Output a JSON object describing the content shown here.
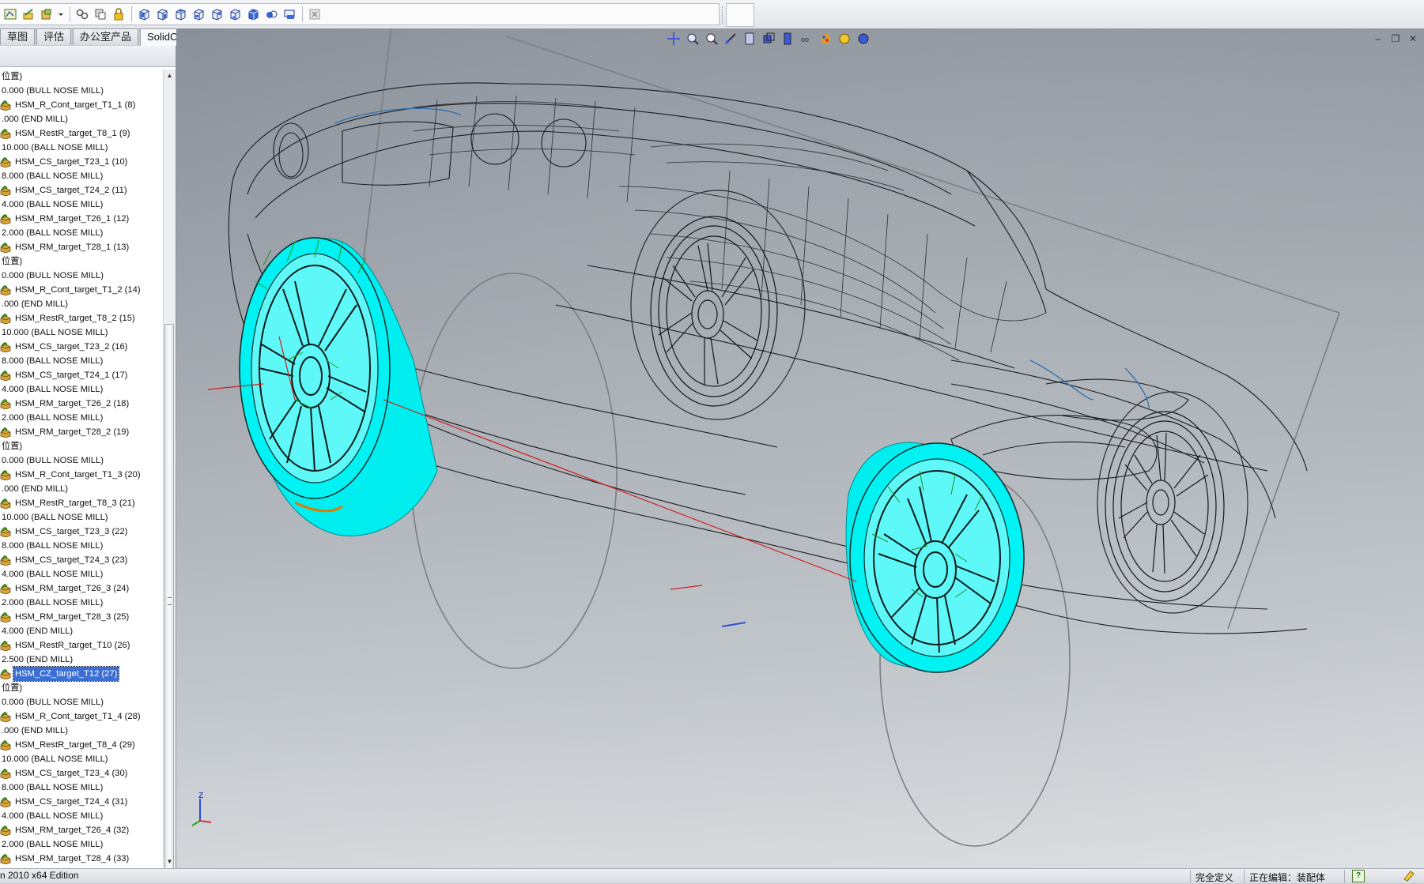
{
  "toolbar": {
    "icons": [
      "sketch-icon",
      "edit-part-icon",
      "component-icon",
      "dropdown-arrow-icon",
      "mate-icon",
      "move-component-icon",
      "lock-icon",
      "view-front-icon",
      "view-back-icon",
      "view-left-icon",
      "view-right-icon",
      "view-top-icon",
      "view-bottom-icon",
      "view-iso-icon",
      "view-trimetric-icon",
      "view-dimetric-icon",
      "close-icon"
    ]
  },
  "tabs": [
    {
      "label": "草图",
      "active": false
    },
    {
      "label": "评估",
      "active": false
    },
    {
      "label": "办公室产品",
      "active": false
    },
    {
      "label": "SolidCAM",
      "active": true
    }
  ],
  "tree": {
    "rows": [
      {
        "text": "位置)",
        "icon": false
      },
      {
        "text": "0.000 (BULL NOSE MILL)",
        "icon": false
      },
      {
        "text": "HSM_R_Cont_target_T1_1 (8)",
        "icon": true
      },
      {
        "text": ".000 (END MILL)",
        "icon": false
      },
      {
        "text": "HSM_RestR_target_T8_1 (9)",
        "icon": true
      },
      {
        "text": "10.000 (BALL NOSE MILL)",
        "icon": false
      },
      {
        "text": "HSM_CS_target_T23_1 (10)",
        "icon": true
      },
      {
        "text": "8.000 (BALL NOSE MILL)",
        "icon": false
      },
      {
        "text": "HSM_CS_target_T24_2 (11)",
        "icon": true
      },
      {
        "text": "4.000 (BALL NOSE MILL)",
        "icon": false
      },
      {
        "text": "HSM_RM_target_T26_1 (12)",
        "icon": true
      },
      {
        "text": "2.000 (BALL NOSE MILL)",
        "icon": false
      },
      {
        "text": "HSM_RM_target_T28_1 (13)",
        "icon": true
      },
      {
        "text": "位置)",
        "icon": false
      },
      {
        "text": "0.000 (BULL NOSE MILL)",
        "icon": false
      },
      {
        "text": "HSM_R_Cont_target_T1_2 (14)",
        "icon": true
      },
      {
        "text": ".000 (END MILL)",
        "icon": false
      },
      {
        "text": "HSM_RestR_target_T8_2 (15)",
        "icon": true
      },
      {
        "text": "10.000 (BALL NOSE MILL)",
        "icon": false
      },
      {
        "text": "HSM_CS_target_T23_2 (16)",
        "icon": true
      },
      {
        "text": "8.000 (BALL NOSE MILL)",
        "icon": false
      },
      {
        "text": "HSM_CS_target_T24_1 (17)",
        "icon": true
      },
      {
        "text": "4.000 (BALL NOSE MILL)",
        "icon": false
      },
      {
        "text": "HSM_RM_target_T26_2 (18)",
        "icon": true
      },
      {
        "text": "2.000 (BALL NOSE MILL)",
        "icon": false
      },
      {
        "text": "HSM_RM_target_T28_2 (19)",
        "icon": true
      },
      {
        "text": "位置)",
        "icon": false
      },
      {
        "text": "0.000 (BULL NOSE MILL)",
        "icon": false
      },
      {
        "text": "HSM_R_Cont_target_T1_3 (20)",
        "icon": true
      },
      {
        "text": ".000 (END MILL)",
        "icon": false
      },
      {
        "text": "HSM_RestR_target_T8_3 (21)",
        "icon": true
      },
      {
        "text": "10.000 (BALL NOSE MILL)",
        "icon": false
      },
      {
        "text": "HSM_CS_target_T23_3 (22)",
        "icon": true
      },
      {
        "text": "8.000 (BALL NOSE MILL)",
        "icon": false
      },
      {
        "text": "HSM_CS_target_T24_3 (23)",
        "icon": true
      },
      {
        "text": "4.000 (BALL NOSE MILL)",
        "icon": false
      },
      {
        "text": "HSM_RM_target_T26_3 (24)",
        "icon": true
      },
      {
        "text": "2.000 (BALL NOSE MILL)",
        "icon": false
      },
      {
        "text": "HSM_RM_target_T28_3 (25)",
        "icon": true
      },
      {
        "text": "4.000 (END MILL)",
        "icon": false
      },
      {
        "text": "HSM_RestR_target_T10 (26)",
        "icon": true
      },
      {
        "text": "2.500 (END MILL)",
        "icon": false
      },
      {
        "text": "HSM_CZ_target_T12 (27)",
        "icon": true,
        "selected": true
      },
      {
        "text": "位置)",
        "icon": false
      },
      {
        "text": "0.000 (BULL NOSE MILL)",
        "icon": false
      },
      {
        "text": "HSM_R_Cont_target_T1_4 (28)",
        "icon": true
      },
      {
        "text": ".000 (END MILL)",
        "icon": false
      },
      {
        "text": "HSM_RestR_target_T8_4 (29)",
        "icon": true
      },
      {
        "text": "10.000 (BALL NOSE MILL)",
        "icon": false
      },
      {
        "text": "HSM_CS_target_T23_4 (30)",
        "icon": true
      },
      {
        "text": "8.000 (BALL NOSE MILL)",
        "icon": false
      },
      {
        "text": "HSM_CS_target_T24_4 (31)",
        "icon": true
      },
      {
        "text": "4.000 (BALL NOSE MILL)",
        "icon": false
      },
      {
        "text": "HSM_RM_target_T26_4 (32)",
        "icon": true
      },
      {
        "text": "2.000 (BALL NOSE MILL)",
        "icon": false
      },
      {
        "text": "HSM_RM_target_T28_4 (33)",
        "icon": true
      }
    ]
  },
  "viewport": {
    "heads_up_icons": [
      "move-icon",
      "zoom-to-fit-icon",
      "zoom-to-area-icon",
      "previous-view-icon",
      "section-view-icon",
      "view-orientation-icon",
      "display-style-icon",
      "hide-show-icon",
      "edit-appearance-icon",
      "apply-scene-icon",
      "view-settings-icon"
    ],
    "window_controls": [
      "minimize-icon",
      "restore-icon",
      "close-icon"
    ],
    "triad_z_label": "Z",
    "toolpath_color": "#00f0f0",
    "wireframe_color": "#1a1c20"
  },
  "status": {
    "left": "n 2010 x64 Edition",
    "definition": "完全定义",
    "editing": "正在编辑：装配体",
    "help": "?"
  }
}
